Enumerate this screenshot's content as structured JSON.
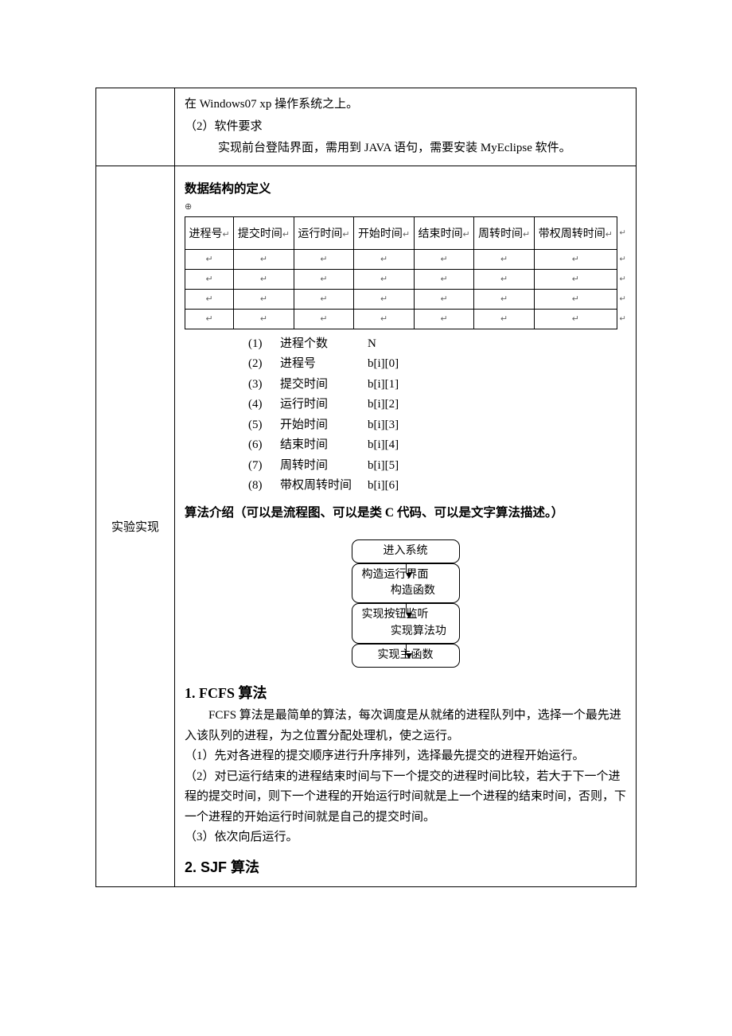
{
  "top_section": {
    "line1": "在 Windows07 xp 操作系统之上。",
    "line2": "（2）软件要求",
    "line3": "实现前台登陆界面，需用到 JAVA 语句，需要安装 MyEclipse 软件。"
  },
  "left_label": "实验实现",
  "data_struct": {
    "title": "数据结构的定义",
    "headers": [
      "进程号",
      "提交时间",
      "运行时间",
      "开始时间",
      "结束时间",
      "周转时间",
      "带权周转时间"
    ],
    "defs": [
      {
        "n": "(1)",
        "label": "进程个数",
        "val": "N"
      },
      {
        "n": "(2)",
        "label": "进程号",
        "val": "b[i][0]"
      },
      {
        "n": "(3)",
        "label": "提交时间",
        "val": "b[i][1]"
      },
      {
        "n": "(4)",
        "label": "运行时间",
        "val": "b[i][2]"
      },
      {
        "n": "(5)",
        "label": "开始时间",
        "val": "b[i][3]"
      },
      {
        "n": "(6)",
        "label": "结束时间",
        "val": "b[i][4]"
      },
      {
        "n": "(7)",
        "label": "周转时间",
        "val": "b[i][5]"
      },
      {
        "n": "(8)",
        "label": "带权周转时间",
        "val": "b[i][6]"
      }
    ]
  },
  "algo_intro": "算法介绍（可以是流程图、可以是类 C 代码、可以是文字算法描述。）",
  "flow": {
    "b1": "进入系统",
    "b2a": "构造运行界面",
    "b2b": "构造函数",
    "b3a": "实现按钮监听",
    "b3b": "实现算法功",
    "b4": "实现主函数"
  },
  "fcfs": {
    "title": "1. FCFS 算法",
    "p1": "FCFS 算法是最简单的算法，每次调度是从就绪的进程队列中，选择一个最先进入该队列的进程，为之位置分配处理机，使之运行。",
    "p2": "（1）先对各进程的提交顺序进行升序排列，选择最先提交的进程开始运行。",
    "p3": "（2）对已运行结束的进程结束时间与下一个提交的进程时间比较，若大于下一个进程的提交时间，则下一个进程的开始运行时间就是上一个进程的结束时间，否则，下一个进程的开始运行时间就是自己的提交时间。",
    "p4": "（3）依次向后运行。"
  },
  "sjf": {
    "title": "2. SJF 算法"
  }
}
